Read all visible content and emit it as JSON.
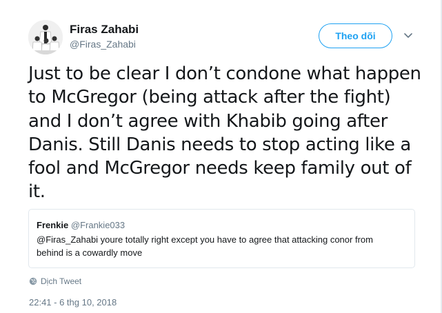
{
  "author": {
    "name": "Firas Zahabi",
    "handle": "@Firas_Zahabi"
  },
  "actions": {
    "follow_label": "Theo dõi",
    "caret_icon": "chevron-down-icon"
  },
  "tweet": {
    "text_lines": [
      "Just to be clear I don’t condone what happen",
      "to McGregor (being attack after the fight)",
      "and I don’t agree with Khabib going after",
      "Danis. Still Danis needs to stop acting like a",
      "fool and McGregor needs keep family out of",
      "it."
    ]
  },
  "quote": {
    "name": "Frenkie",
    "handle": "@Frankie033",
    "text_lines": [
      "@Firas_Zahabi youre totally right except you have to agree that attacking conor from",
      "behind is a cowardly move"
    ]
  },
  "footer": {
    "translate_label": "Dịch Tweet",
    "translate_icon": "globe-icon",
    "timestamp": "22:41 - 6 thg 10, 2018"
  },
  "colors": {
    "accent": "#1da1f2",
    "text": "#14171a",
    "muted": "#657786",
    "border": "#e1e8ed"
  }
}
